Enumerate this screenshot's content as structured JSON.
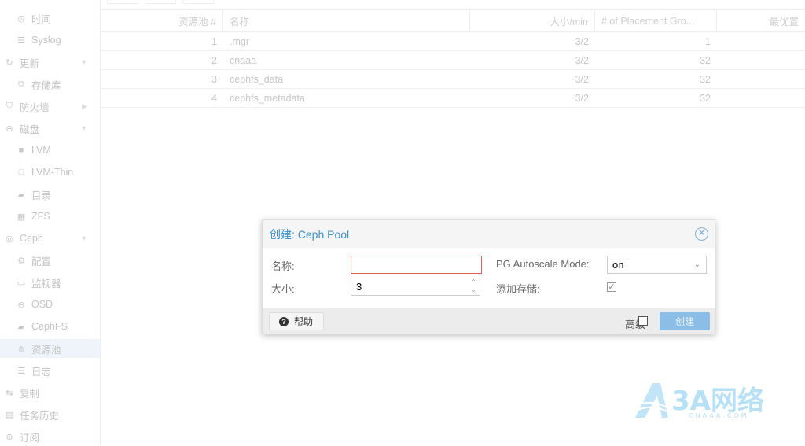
{
  "sidebar": {
    "items": [
      {
        "label": "时间",
        "icon": "clock-icon"
      },
      {
        "label": "Syslog",
        "icon": "list-icon"
      },
      {
        "label": "更新",
        "icon": "refresh-icon"
      },
      {
        "label": "存储库",
        "icon": "copy-icon"
      },
      {
        "label": "防火墙",
        "icon": "shield-icon"
      },
      {
        "label": "磁盘",
        "icon": "hdd-icon"
      },
      {
        "label": "LVM",
        "icon": "square-icon"
      },
      {
        "label": "LVM-Thin",
        "icon": "square-outline-icon"
      },
      {
        "label": "目录",
        "icon": "folder-icon"
      },
      {
        "label": "ZFS",
        "icon": "grid-icon"
      },
      {
        "label": "Ceph",
        "icon": "ceph-icon"
      },
      {
        "label": "配置",
        "icon": "gear-icon"
      },
      {
        "label": "监视器",
        "icon": "desktop-icon"
      },
      {
        "label": "OSD",
        "icon": "hdd-icon"
      },
      {
        "label": "CephFS",
        "icon": "folder-icon"
      },
      {
        "label": "资源池",
        "icon": "sitemap-icon"
      },
      {
        "label": "日志",
        "icon": "list-icon"
      },
      {
        "label": "复制",
        "icon": "retweet-icon"
      },
      {
        "label": "任务历史",
        "icon": "list-alt-icon"
      },
      {
        "label": "订阅",
        "icon": "support-icon"
      }
    ]
  },
  "table": {
    "headers": [
      "资源池 #",
      "名称",
      "大小/min",
      "# of Placement Gro...",
      "最优置"
    ],
    "rows": [
      [
        "1",
        ".mgr",
        "3/2",
        "1",
        ""
      ],
      [
        "2",
        "cnaaa",
        "3/2",
        "32",
        ""
      ],
      [
        "3",
        "cephfs_data",
        "3/2",
        "32",
        ""
      ],
      [
        "4",
        "cephfs_metadata",
        "3/2",
        "32",
        ""
      ]
    ]
  },
  "dialog": {
    "title": "创建: Ceph Pool",
    "name_label": "名称:",
    "name_value": "",
    "size_label": "大小:",
    "size_value": "3",
    "autoscale_label": "PG Autoscale Mode:",
    "autoscale_value": "on",
    "add_storage_label": "添加存储:",
    "add_storage_checked": true,
    "help_label": "帮助",
    "advanced_label": "高级",
    "advanced_checked": false,
    "create_label": "创建"
  },
  "watermark": {
    "text": "3A网络",
    "sub": "CNAAA.COM"
  },
  "colors": {
    "accent": "#3892d4",
    "create_button": "#8cbde6",
    "invalid_border": "#e0604c"
  }
}
